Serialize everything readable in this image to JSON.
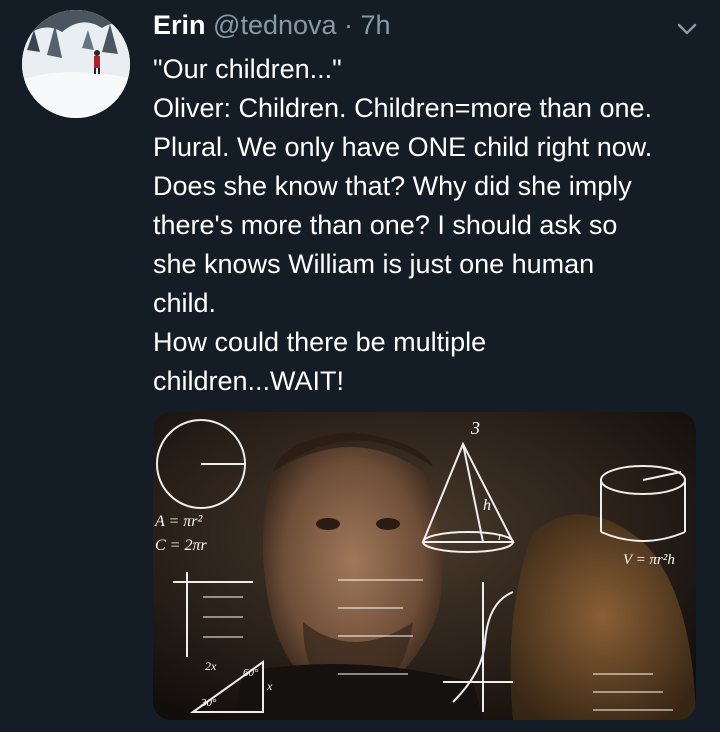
{
  "tweet": {
    "display_name": "Erin",
    "handle": "@tednova",
    "separator": " · ",
    "time": "7h",
    "text_lines": [
      "\"Our children...\"",
      "Oliver: Children. Children=more than one.",
      "Plural. We only have ONE child right now.",
      "Does she know that? Why did she imply",
      "there's more than one? I should ask so",
      "she knows William is just one human",
      "child.",
      "How could there be multiple",
      "children...WAIT!"
    ]
  },
  "icons": {
    "more_menu": "chevron-down-icon"
  },
  "media": {
    "description_icon": "math-lady-meme-image",
    "formula_texts": {
      "top_number": "3",
      "area": "A = πr²",
      "circumference": "C = 2πr",
      "volume": "V = πr²h",
      "cone_height": "h",
      "radius_r": "r",
      "triangle_2x": "2x",
      "triangle_60": "60°",
      "triangle_30": "30°",
      "triangle_x": "x"
    }
  },
  "colors": {
    "background": "#141d26",
    "secondary_text": "#8899a6",
    "primary_text": "#ffffff"
  }
}
